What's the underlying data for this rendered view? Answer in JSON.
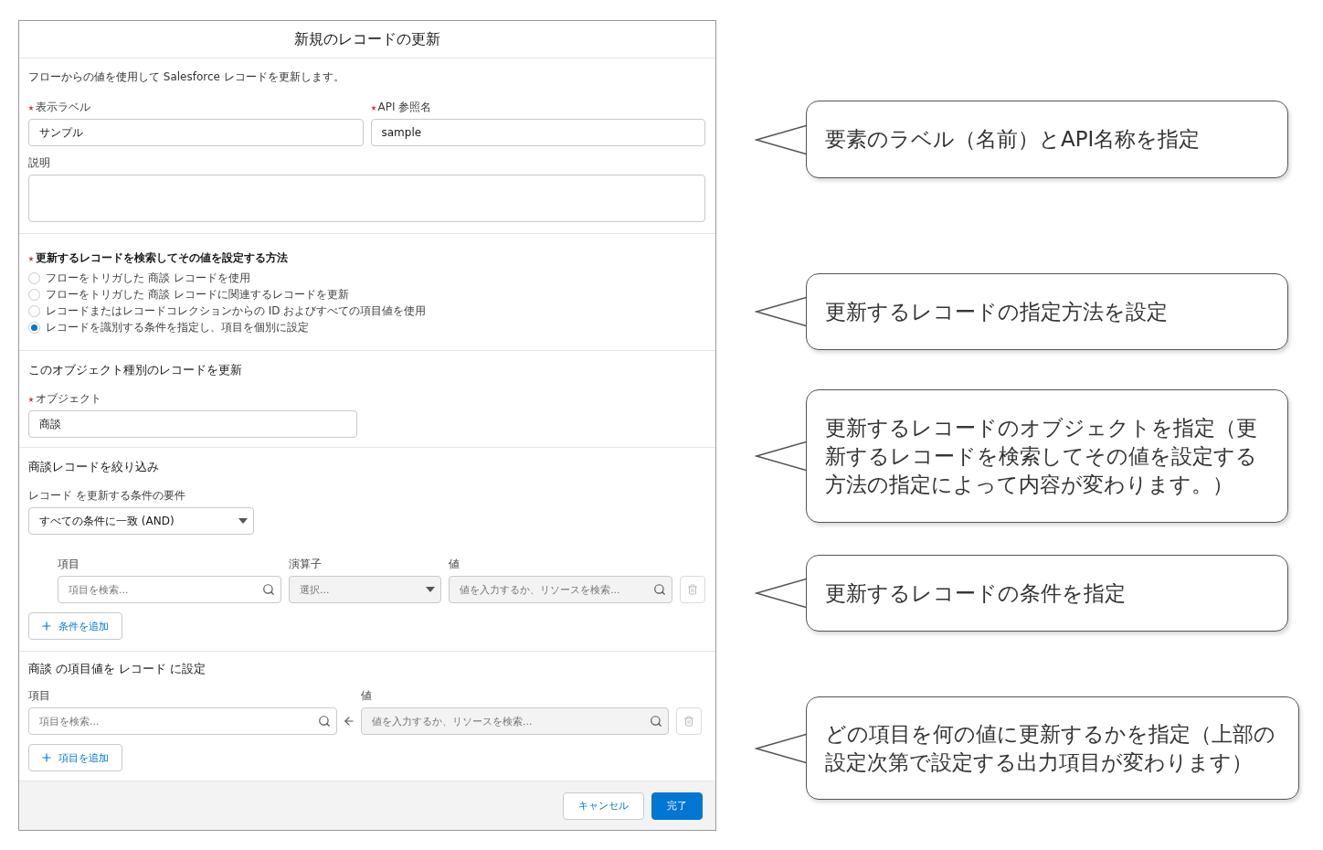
{
  "dialog": {
    "title": "新規のレコードの更新",
    "description": "フローからの値を使用して Salesforce レコードを更新します。",
    "fields": [
      {
        "label": "表示ラベル",
        "required": true,
        "value": "サンプル"
      },
      {
        "label": "API 参照名",
        "required": true,
        "value": "sample"
      }
    ],
    "description_field": {
      "label": "説明"
    },
    "method": {
      "label": "更新するレコードを検索してその値を設定する方法",
      "required": true,
      "options": [
        {
          "label": "フローをトリガした 商談 レコードを使用",
          "selected": false
        },
        {
          "label": "フローをトリガした 商談 レコードに関連するレコードを更新",
          "selected": false
        },
        {
          "label": "レコードまたはレコードコレクションからの ID およびすべての項目値を使用",
          "selected": false
        },
        {
          "label": "レコードを識別する条件を指定し、項目を個別に設定",
          "selected": true
        }
      ]
    },
    "object_section": {
      "heading": "このオブジェクト種別のレコードを更新",
      "label": "オブジェクト",
      "required": true,
      "value": "商談"
    },
    "filter_section": {
      "heading": "商談レコードを絞り込み",
      "requirement_label": "レコード を更新する条件の要件",
      "requirement_value": "すべての条件に一致 (AND)",
      "columns": [
        "項目",
        "演算子",
        "値"
      ],
      "field_placeholder": "項目を検索...",
      "operator_placeholder": "選択...",
      "value_placeholder": "値を入力するか、リソースを検索...",
      "add_button": "条件を追加"
    },
    "assign_section": {
      "heading": "商談 の項目値を レコード に設定",
      "columns": [
        "項目",
        "値"
      ],
      "field_placeholder": "項目を検索...",
      "value_placeholder": "値を入力するか、リソースを検索...",
      "add_button": "項目を追加"
    },
    "buttons": [
      {
        "label": "キャンセル",
        "kind": "neutral"
      },
      {
        "label": "完了",
        "kind": "brand"
      }
    ]
  },
  "callouts": [
    {
      "text": "要素のラベル（名前）とAPI名称を指定"
    },
    {
      "text": "更新するレコードの指定方法を設定"
    },
    {
      "text": "更新するレコードのオブジェクトを指定（更新するレコードを検索してその値を設定する方法の指定によって内容が変わります。）"
    },
    {
      "text": "更新するレコードの条件を指定"
    },
    {
      "text": "どの項目を何の値に更新するかを指定（上部の設定次第で設定する出力項目が変わります）"
    }
  ]
}
